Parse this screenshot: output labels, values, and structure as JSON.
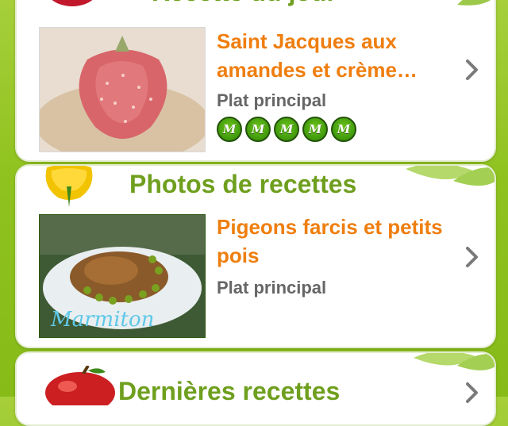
{
  "sections": {
    "recipe_of_day": {
      "title": "Recette du jour",
      "recipe_name": "Saint Jacques aux amandes et crème…",
      "category": "Plat principal",
      "rating_badge": "M",
      "rating": 5,
      "rating_max": 5,
      "icons": {
        "section": "strawberry-icon",
        "photo": "strawberry-photo",
        "chevron": "chevron-right-icon"
      }
    },
    "recipe_photos": {
      "title": "Photos de recettes",
      "recipe_name": "Pigeons farcis et petits pois",
      "category": "Plat principal",
      "photo_watermark": "Marmiton",
      "icons": {
        "section": "bell-pepper-icon",
        "photo": "stuffed-pigeon-photo",
        "chevron": "chevron-right-icon"
      }
    },
    "latest_recipes": {
      "title": "Dernières recettes",
      "icons": {
        "section": "apple-icon",
        "chevron": "chevron-right-icon"
      }
    }
  },
  "colors": {
    "background": "#8fc21f",
    "title_green": "#6f9f1e",
    "recipe_orange": "#ef7e0f",
    "category_gray": "#666666",
    "badge_green": "#3f9a0c"
  }
}
